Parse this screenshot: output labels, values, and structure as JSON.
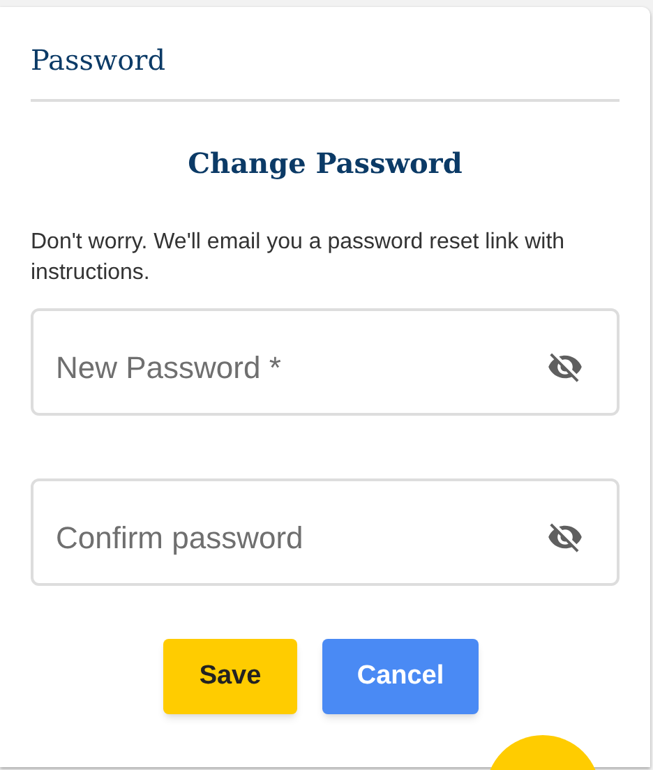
{
  "header": {
    "title": "Password"
  },
  "heading": "Change Password",
  "description": "Don't worry. We'll email you a password reset link with instructions.",
  "fields": [
    {
      "placeholder": "New Password *",
      "password_visible": false
    },
    {
      "placeholder": "Confirm password",
      "password_visible": false
    }
  ],
  "buttons": [
    {
      "label": "Save",
      "kind": "primary"
    },
    {
      "label": "Cancel",
      "kind": "secondary"
    }
  ],
  "fab": {
    "kind": "partial"
  }
}
